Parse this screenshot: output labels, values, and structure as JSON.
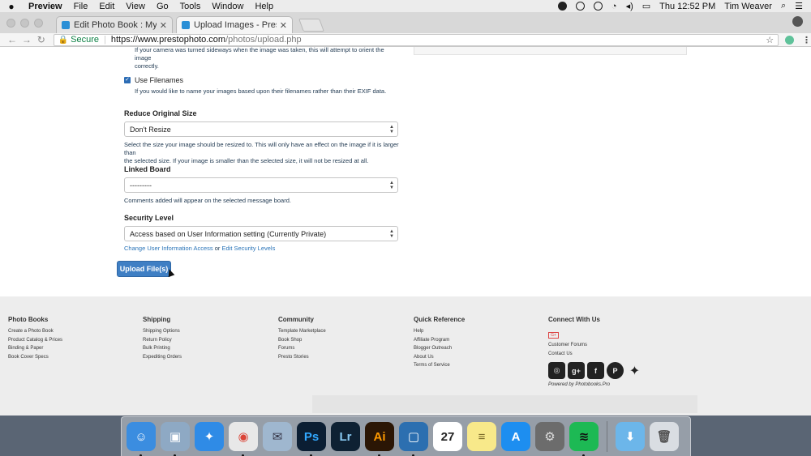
{
  "menubar": {
    "app": "Preview",
    "items": [
      "File",
      "Edit",
      "View",
      "Go",
      "Tools",
      "Window",
      "Help"
    ],
    "clock": "Thu 12:52 PM",
    "user": "Tim Weaver"
  },
  "tabs": [
    {
      "label": "Edit Photo Book : My Year - Pr",
      "active": false
    },
    {
      "label": "Upload Images - PrestoPhoto",
      "active": true
    }
  ],
  "address": {
    "secure_label": "Secure",
    "url_base": "https://www.prestophoto.com",
    "url_path": "/photos/upload.php"
  },
  "form": {
    "rotate_help_line1": "If your camera was turned sideways when the image was taken, this will attempt to orient the image",
    "rotate_help_line2": "correctly.",
    "use_filenames_label": "Use Filenames",
    "use_filenames_checked": true,
    "use_filenames_help": "If you would like to name your images based upon their filenames rather than their EXIF data.",
    "resize_label": "Reduce Original Size",
    "resize_value": "Don't Resize",
    "resize_help_line1": "Select the size your image should be resized to. This will only have an effect on the image if it is larger than",
    "resize_help_line2": "the selected size. If your image is smaller than the selected size, it will not be resized at all.",
    "board_label": "Linked Board",
    "board_value": "---------",
    "board_help": "Comments added will appear on the selected message board.",
    "security_label": "Security Level",
    "security_value": "Access based on User Information setting (Currently Private)",
    "security_link1": "Change User Information Access",
    "security_or": " or ",
    "security_link2": "Edit Security Levels",
    "upload_button": "Upload File(s)"
  },
  "footer": {
    "columns": [
      {
        "title": "Photo Books",
        "links": [
          "Create a Photo Book",
          "Product Catalog & Prices",
          "Binding & Paper",
          "Book Cover Specs"
        ]
      },
      {
        "title": "Shipping",
        "links": [
          "Shipping Options",
          "Return Policy",
          "Bulk Printing",
          "Expediting Orders"
        ]
      },
      {
        "title": "Community",
        "links": [
          "Template Marketplace",
          "Book Shop",
          "Forums",
          "Presto Stories"
        ]
      },
      {
        "title": "Quick Reference",
        "links": [
          "Help",
          "Affiliate Program",
          "Blogger Outreach",
          "About Us",
          "Terms of Service"
        ]
      }
    ],
    "connect": {
      "title": "Connect With Us",
      "gplus_badge": "G+",
      "links": [
        "Customer Forums",
        "Contact Us"
      ],
      "powered": "Powered by Photobooks.Pro"
    }
  },
  "dock": {
    "icons": [
      {
        "name": "finder-icon",
        "bg": "#3b8de0",
        "glyph": "☺",
        "color": "#fff",
        "running": true
      },
      {
        "name": "preview-icon",
        "bg": "#8ea9c4",
        "glyph": "▣",
        "color": "#fff",
        "running": true
      },
      {
        "name": "safari-icon",
        "bg": "#2f8be6",
        "glyph": "✦",
        "color": "#fff",
        "running": false
      },
      {
        "name": "chrome-icon",
        "bg": "#e8e8e8",
        "glyph": "◉",
        "color": "#db4437",
        "running": true
      },
      {
        "name": "migration-icon",
        "bg": "#9fb7cf",
        "glyph": "✉",
        "color": "#334",
        "running": false
      },
      {
        "name": "photoshop-icon",
        "bg": "#0b1e33",
        "glyph": "Ps",
        "color": "#31a8ff",
        "running": true
      },
      {
        "name": "lightroom-icon",
        "bg": "#0e2133",
        "glyph": "Lr",
        "color": "#87c7f0",
        "running": false
      },
      {
        "name": "illustrator-icon",
        "bg": "#2b1605",
        "glyph": "Ai",
        "color": "#ff9a00",
        "running": true
      },
      {
        "name": "app-icon",
        "bg": "#2c6fb0",
        "glyph": "▢",
        "color": "#fff",
        "running": true
      },
      {
        "name": "calendar-icon",
        "bg": "#ffffff",
        "glyph": "27",
        "color": "#222",
        "running": false
      },
      {
        "name": "notes-icon",
        "bg": "#f8e98a",
        "glyph": "≡",
        "color": "#7a6a2a",
        "running": false
      },
      {
        "name": "app-store-icon",
        "bg": "#1d8ef0",
        "glyph": "A",
        "color": "#fff",
        "running": false
      },
      {
        "name": "system-preferences-icon",
        "bg": "#6c6c6c",
        "glyph": "⚙",
        "color": "#ddd",
        "running": false
      },
      {
        "name": "spotify-icon",
        "bg": "#1db954",
        "glyph": "≋",
        "color": "#111",
        "running": true
      }
    ],
    "right_icons": [
      {
        "name": "downloads-folder-icon",
        "bg": "#6cb6ea",
        "glyph": "⬇",
        "color": "#fff",
        "running": false
      },
      {
        "name": "trash-icon",
        "bg": "#d9dde2",
        "glyph": "🗑",
        "color": "#555",
        "running": false
      }
    ]
  },
  "colors": {
    "accent": "#3f7fc4",
    "link": "#2a74b8",
    "footer_bg": "#ededed"
  }
}
